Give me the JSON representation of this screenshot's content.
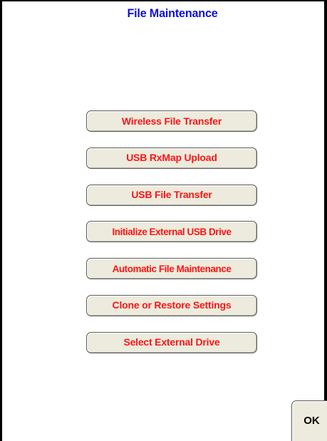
{
  "screen": {
    "title": "File Maintenance"
  },
  "menu": {
    "items": [
      {
        "label": "Wireless File Transfer"
      },
      {
        "label": "USB RxMap Upload"
      },
      {
        "label": "USB File Transfer"
      },
      {
        "label": "Initialize External USB Drive"
      },
      {
        "label": "Automatic File Maintenance"
      },
      {
        "label": "Clone or Restore Settings"
      },
      {
        "label": "Select External Drive"
      }
    ]
  },
  "footer": {
    "ok_label": "OK"
  },
  "colors": {
    "title": "#1010e0",
    "button_text": "#ff1414",
    "button_face": "#ecebdd",
    "frame": "#000000"
  }
}
